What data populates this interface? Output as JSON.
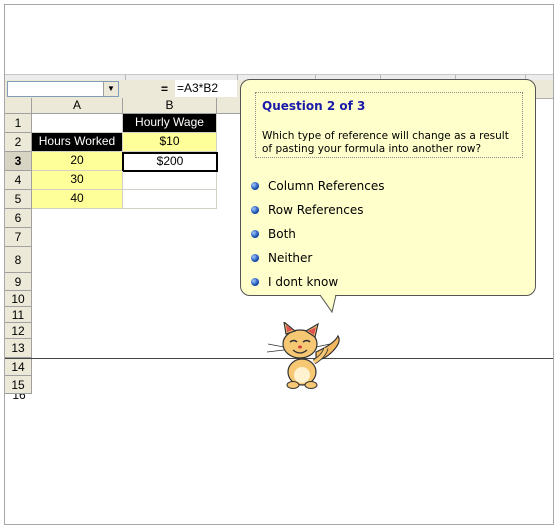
{
  "formula_bar": {
    "name_box": "",
    "equals": "=",
    "formula": "=A3*B2"
  },
  "columns": [
    "A",
    "B"
  ],
  "rows": [
    "1",
    "2",
    "3",
    "4",
    "5",
    "6",
    "7",
    "8",
    "9",
    "10",
    "11",
    "12",
    "13",
    "14",
    "15"
  ],
  "cells": {
    "B1": "Hourly Wage",
    "A2": "Hours Worked",
    "B2": "$10",
    "A3": "20",
    "B3": "$200",
    "A4": "30",
    "A5": "40"
  },
  "quiz": {
    "title": "Question 2 of 3",
    "question": "Which type of reference will change as a result of pasting your formula into another row?",
    "options": [
      "Column References",
      "Row References",
      "Both",
      "Neither",
      "I dont know"
    ]
  },
  "colors": {
    "highlight": "#ffff99",
    "bubble": "#ffffcc",
    "title": "#1a1aaa"
  },
  "icons": {
    "cat": "cartoon-cat-assistant-icon",
    "bullet": "blue-sphere-bullet-icon",
    "dropdown": "dropdown-arrow-icon"
  }
}
